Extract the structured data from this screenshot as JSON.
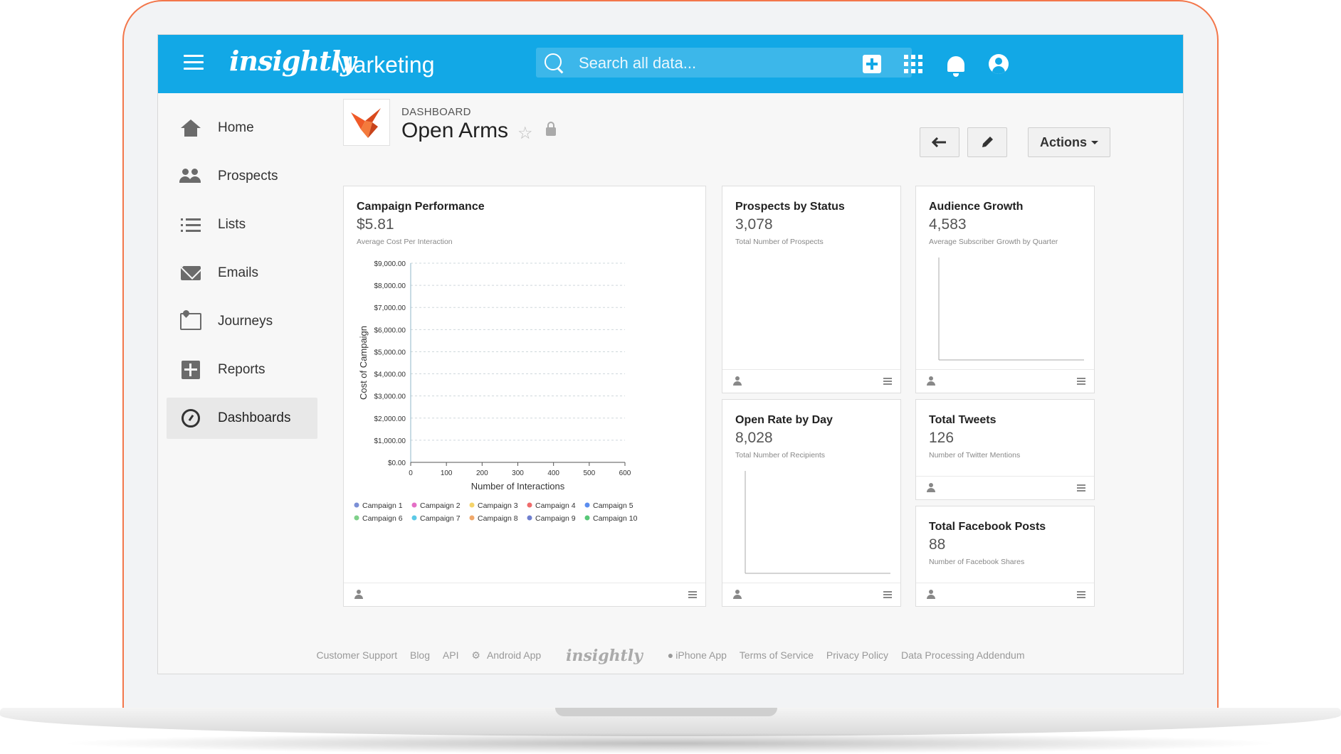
{
  "topbar": {
    "logo": "insightly",
    "app_name": "Marketing",
    "search_placeholder": "Search all data..."
  },
  "sidebar": {
    "items": [
      {
        "label": "Home",
        "icon": "home-icon"
      },
      {
        "label": "Prospects",
        "icon": "people-icon"
      },
      {
        "label": "Lists",
        "icon": "list-icon"
      },
      {
        "label": "Emails",
        "icon": "mail-icon"
      },
      {
        "label": "Journeys",
        "icon": "map-icon"
      },
      {
        "label": "Reports",
        "icon": "report-icon"
      },
      {
        "label": "Dashboards",
        "icon": "dashboard-icon",
        "active": true
      }
    ]
  },
  "header": {
    "kicker": "DASHBOARD",
    "title": "Open Arms",
    "actions_label": "Actions"
  },
  "cards": {
    "campaign": {
      "title": "Campaign Performance",
      "value": "$5.81",
      "sub": "Average Cost Per Interaction"
    },
    "prospects": {
      "title": "Prospects by Status",
      "value": "3,078",
      "sub": "Total Number of Prospects"
    },
    "audience": {
      "title": "Audience Growth",
      "value": "4,583",
      "sub": "Average Subscriber Growth by Quarter"
    },
    "openrate": {
      "title": "Open Rate by Day",
      "value": "8,028",
      "sub": "Total Number of Recipients"
    },
    "tweets": {
      "title": "Total Tweets",
      "value": "126",
      "sub": "Number of Twitter Mentions"
    },
    "facebook": {
      "title": "Total Facebook Posts",
      "value": "88",
      "sub": "Number of Facebook Shares"
    }
  },
  "chart_data": {
    "type": "scatter",
    "xlabel": "Number of Interactions",
    "ylabel": "Cost of Campaign",
    "xlim": [
      0,
      600
    ],
    "ylim": [
      0,
      9000
    ],
    "x_ticks": [
      "0",
      "100",
      "200",
      "300",
      "400",
      "500",
      "600"
    ],
    "y_ticks": [
      "$0.00",
      "$1,000.00",
      "$2,000.00",
      "$3,000.00",
      "$4,000.00",
      "$5,000.00",
      "$6,000.00",
      "$7,000.00",
      "$8,000.00",
      "$9,000.00"
    ],
    "grid": true,
    "legend_position": "bottom",
    "series": [
      {
        "name": "Campaign 1",
        "color": "#7b8fd6",
        "values": []
      },
      {
        "name": "Campaign 2",
        "color": "#e46fc6",
        "values": []
      },
      {
        "name": "Campaign 3",
        "color": "#f5d46a",
        "values": []
      },
      {
        "name": "Campaign 4",
        "color": "#ef6b6b",
        "values": []
      },
      {
        "name": "Campaign 5",
        "color": "#5b8def",
        "values": []
      },
      {
        "name": "Campaign 6",
        "color": "#7fd08a",
        "values": []
      },
      {
        "name": "Campaign 7",
        "color": "#5cc9e6",
        "values": []
      },
      {
        "name": "Campaign 8",
        "color": "#f0a86a",
        "values": []
      },
      {
        "name": "Campaign 9",
        "color": "#6f7fcf",
        "values": []
      },
      {
        "name": "Campaign 10",
        "color": "#58c878",
        "values": []
      }
    ]
  },
  "footer": {
    "links": [
      "Customer Support",
      "Blog",
      "API",
      "Android App"
    ],
    "logo": "insightly",
    "links_right": [
      "iPhone App",
      "Terms of Service",
      "Privacy Policy",
      "Data Processing Addendum"
    ]
  },
  "colors": {
    "brand_blue": "#12a8e6",
    "laptop_outline": "#f3764a",
    "logo_orange": "#f05a28"
  }
}
